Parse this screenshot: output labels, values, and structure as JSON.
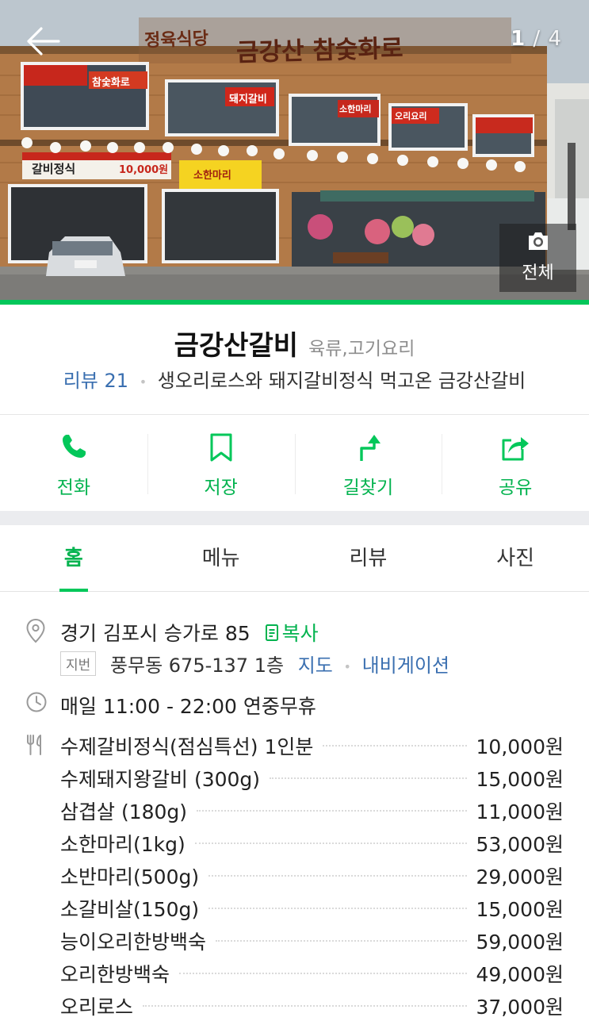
{
  "hero": {
    "counter_current": "1",
    "counter_separator": "/",
    "counter_total": "4",
    "view_all_label": "전체",
    "signs": {
      "main_small": "정육식당",
      "main_big": "금강산 참숯화로",
      "left_top": "참숯화로",
      "galbi_sign": "돼지갈비",
      "hanbang_sign": "소한마리",
      "duck_sign": "오리요리",
      "set_sign": "갈비정식",
      "set_price": "10,000원",
      "yellow_sign": "소한마리"
    }
  },
  "place": {
    "name": "금강산갈비",
    "category": "육류,고기요리",
    "review_label": "리뷰 21",
    "review_title": "생오리로스와 돼지갈비정식 먹고온 금강산갈비"
  },
  "actions": [
    {
      "label": "전화",
      "icon": "phone-icon"
    },
    {
      "label": "저장",
      "icon": "bookmark-icon"
    },
    {
      "label": "길찾기",
      "icon": "directions-icon"
    },
    {
      "label": "공유",
      "icon": "share-icon"
    }
  ],
  "tabs": [
    {
      "label": "홈",
      "active": true
    },
    {
      "label": "메뉴",
      "active": false
    },
    {
      "label": "리뷰",
      "active": false
    },
    {
      "label": "사진",
      "active": false
    }
  ],
  "info": {
    "address": "경기 김포시 승가로 85",
    "copy_label": "복사",
    "jibun_tag": "지번",
    "jibun_address": "풍무동 675-137 1층",
    "map_link": "지도",
    "navi_link": "내비게이션",
    "hours": "매일 11:00 - 22:00 연중무휴"
  },
  "menu": [
    {
      "name": "수제갈비정식(점심특선) 1인분",
      "price": "10,000원"
    },
    {
      "name": "수제돼지왕갈비 (300g)",
      "price": "15,000원"
    },
    {
      "name": "삼겹살 (180g)",
      "price": "11,000원"
    },
    {
      "name": "소한마리(1kg)",
      "price": "53,000원"
    },
    {
      "name": "소반마리(500g)",
      "price": "29,000원"
    },
    {
      "name": "소갈비살(150g)",
      "price": "15,000원"
    },
    {
      "name": "능이오리한방백숙",
      "price": "59,000원"
    },
    {
      "name": "오리한방백숙",
      "price": "49,000원"
    },
    {
      "name": "오리로스",
      "price": "37,000원"
    }
  ],
  "colors": {
    "accent_green": "#03c75a",
    "link_blue": "#3a6fb0",
    "category_gray": "#8e8e8e"
  }
}
